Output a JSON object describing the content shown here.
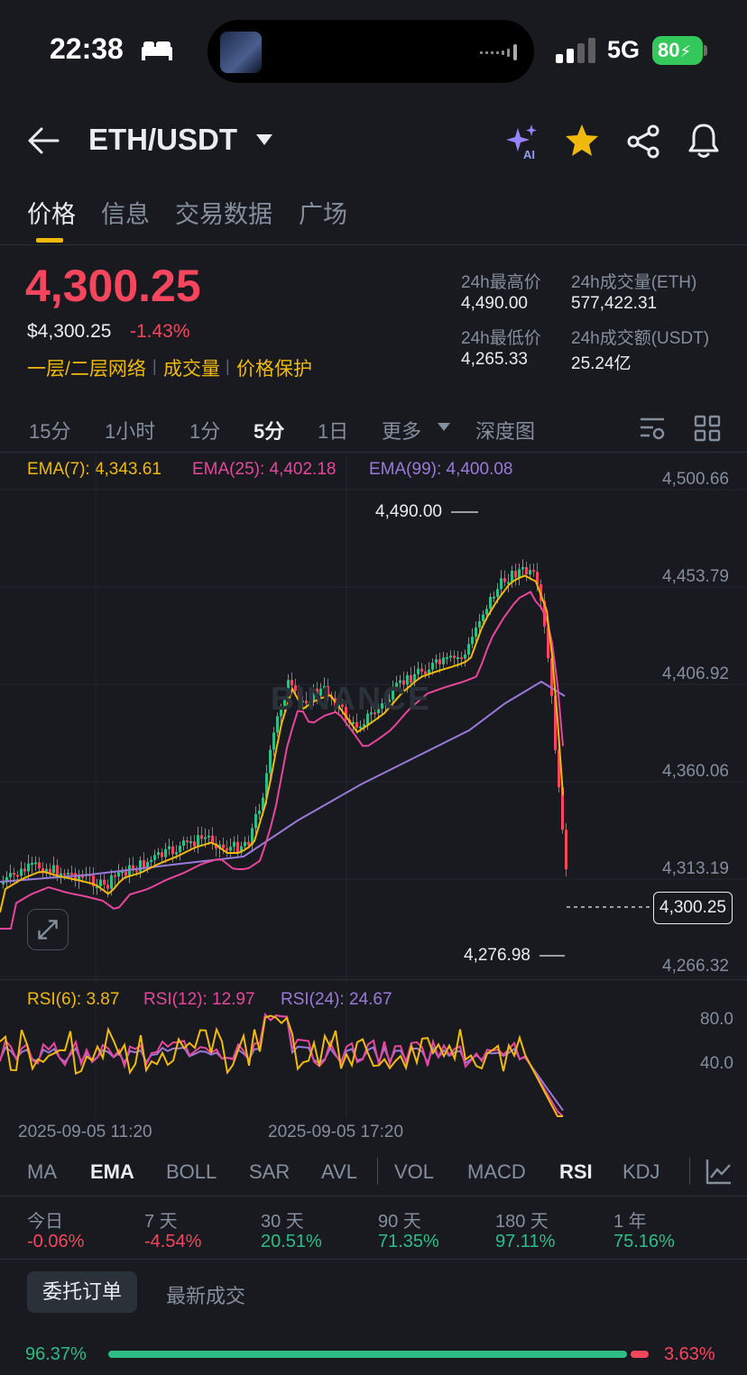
{
  "status_bar": {
    "time": "22:38",
    "network": "5G",
    "battery": "80"
  },
  "header": {
    "pair": "ETH/USDT"
  },
  "tabs": [
    "价格",
    "信息",
    "交易数据",
    "广场"
  ],
  "price": {
    "last": "4,300.25",
    "usd": "$4,300.25",
    "change": "-1.43%",
    "links": [
      "一层/二层网络",
      "成交量",
      "价格保护"
    ]
  },
  "stats": {
    "high_label": "24h最高价",
    "high": "4,490.00",
    "low_label": "24h最低价",
    "low": "4,265.33",
    "vol_label": "24h成交量(ETH)",
    "vol": "577,422.31",
    "amt_label": "24h成交额(USDT)",
    "amt": "25.24亿"
  },
  "intervals": [
    "15分",
    "1小时",
    "1分",
    "5分",
    "1日",
    "更多",
    "深度图"
  ],
  "active_interval": "5分",
  "ema_legend": {
    "ema7": "EMA(7): 4,343.61",
    "ema25": "EMA(25): 4,402.18",
    "ema99": "EMA(99): 4,400.08"
  },
  "price_axis": [
    "4,500.66",
    "4,453.79",
    "4,406.92",
    "4,360.06",
    "4,313.19",
    "4,266.32"
  ],
  "current_price_tag": "4,300.25",
  "high_marker": "4,490.00",
  "low_marker": "4,276.98",
  "watermark": "BINANCE",
  "rsi_legend": {
    "rsi6": "RSI(6): 3.87",
    "rsi12": "RSI(12): 12.97",
    "rsi24": "RSI(24): 24.67"
  },
  "rsi_axis": [
    "80.0",
    "40.0"
  ],
  "time_axis": [
    "2025-09-05 11:20",
    "2025-09-05 17:20"
  ],
  "indicators": [
    "MA",
    "EMA",
    "BOLL",
    "SAR",
    "AVL",
    "VOL",
    "MACD",
    "RSI",
    "KDJ"
  ],
  "periods": [
    {
      "label": "今日",
      "value": "-0.06%",
      "dir": "neg"
    },
    {
      "label": "7 天",
      "value": "-4.54%",
      "dir": "neg"
    },
    {
      "label": "30 天",
      "value": "20.51%",
      "dir": "pos"
    },
    {
      "label": "90 天",
      "value": "71.35%",
      "dir": "pos"
    },
    {
      "label": "180 天",
      "value": "97.11%",
      "dir": "pos"
    },
    {
      "label": "1 年",
      "value": "75.16%",
      "dir": "pos"
    }
  ],
  "order_tabs": [
    "委托订单",
    "最新成交"
  ],
  "ratio": {
    "buy": "96.37%",
    "sell": "3.63%"
  },
  "colors": {
    "up": "#2ebd85",
    "down": "#f6465d",
    "accent": "#f0b90b",
    "ema7": "#f0b90b",
    "ema25": "#e8469b",
    "ema99": "#9a7ad8"
  }
}
